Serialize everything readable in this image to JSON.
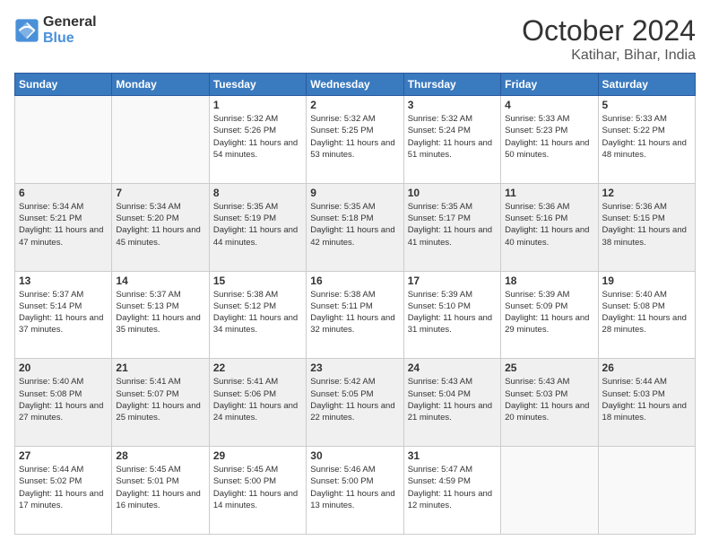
{
  "logo": {
    "line1": "General",
    "line2": "Blue"
  },
  "header": {
    "month": "October 2024",
    "location": "Katihar, Bihar, India"
  },
  "weekdays": [
    "Sunday",
    "Monday",
    "Tuesday",
    "Wednesday",
    "Thursday",
    "Friday",
    "Saturday"
  ],
  "weeks": [
    [
      {
        "day": "",
        "info": ""
      },
      {
        "day": "",
        "info": ""
      },
      {
        "day": "1",
        "info": "Sunrise: 5:32 AM\nSunset: 5:26 PM\nDaylight: 11 hours and 54 minutes."
      },
      {
        "day": "2",
        "info": "Sunrise: 5:32 AM\nSunset: 5:25 PM\nDaylight: 11 hours and 53 minutes."
      },
      {
        "day": "3",
        "info": "Sunrise: 5:32 AM\nSunset: 5:24 PM\nDaylight: 11 hours and 51 minutes."
      },
      {
        "day": "4",
        "info": "Sunrise: 5:33 AM\nSunset: 5:23 PM\nDaylight: 11 hours and 50 minutes."
      },
      {
        "day": "5",
        "info": "Sunrise: 5:33 AM\nSunset: 5:22 PM\nDaylight: 11 hours and 48 minutes."
      }
    ],
    [
      {
        "day": "6",
        "info": "Sunrise: 5:34 AM\nSunset: 5:21 PM\nDaylight: 11 hours and 47 minutes."
      },
      {
        "day": "7",
        "info": "Sunrise: 5:34 AM\nSunset: 5:20 PM\nDaylight: 11 hours and 45 minutes."
      },
      {
        "day": "8",
        "info": "Sunrise: 5:35 AM\nSunset: 5:19 PM\nDaylight: 11 hours and 44 minutes."
      },
      {
        "day": "9",
        "info": "Sunrise: 5:35 AM\nSunset: 5:18 PM\nDaylight: 11 hours and 42 minutes."
      },
      {
        "day": "10",
        "info": "Sunrise: 5:35 AM\nSunset: 5:17 PM\nDaylight: 11 hours and 41 minutes."
      },
      {
        "day": "11",
        "info": "Sunrise: 5:36 AM\nSunset: 5:16 PM\nDaylight: 11 hours and 40 minutes."
      },
      {
        "day": "12",
        "info": "Sunrise: 5:36 AM\nSunset: 5:15 PM\nDaylight: 11 hours and 38 minutes."
      }
    ],
    [
      {
        "day": "13",
        "info": "Sunrise: 5:37 AM\nSunset: 5:14 PM\nDaylight: 11 hours and 37 minutes."
      },
      {
        "day": "14",
        "info": "Sunrise: 5:37 AM\nSunset: 5:13 PM\nDaylight: 11 hours and 35 minutes."
      },
      {
        "day": "15",
        "info": "Sunrise: 5:38 AM\nSunset: 5:12 PM\nDaylight: 11 hours and 34 minutes."
      },
      {
        "day": "16",
        "info": "Sunrise: 5:38 AM\nSunset: 5:11 PM\nDaylight: 11 hours and 32 minutes."
      },
      {
        "day": "17",
        "info": "Sunrise: 5:39 AM\nSunset: 5:10 PM\nDaylight: 11 hours and 31 minutes."
      },
      {
        "day": "18",
        "info": "Sunrise: 5:39 AM\nSunset: 5:09 PM\nDaylight: 11 hours and 29 minutes."
      },
      {
        "day": "19",
        "info": "Sunrise: 5:40 AM\nSunset: 5:08 PM\nDaylight: 11 hours and 28 minutes."
      }
    ],
    [
      {
        "day": "20",
        "info": "Sunrise: 5:40 AM\nSunset: 5:08 PM\nDaylight: 11 hours and 27 minutes."
      },
      {
        "day": "21",
        "info": "Sunrise: 5:41 AM\nSunset: 5:07 PM\nDaylight: 11 hours and 25 minutes."
      },
      {
        "day": "22",
        "info": "Sunrise: 5:41 AM\nSunset: 5:06 PM\nDaylight: 11 hours and 24 minutes."
      },
      {
        "day": "23",
        "info": "Sunrise: 5:42 AM\nSunset: 5:05 PM\nDaylight: 11 hours and 22 minutes."
      },
      {
        "day": "24",
        "info": "Sunrise: 5:43 AM\nSunset: 5:04 PM\nDaylight: 11 hours and 21 minutes."
      },
      {
        "day": "25",
        "info": "Sunrise: 5:43 AM\nSunset: 5:03 PM\nDaylight: 11 hours and 20 minutes."
      },
      {
        "day": "26",
        "info": "Sunrise: 5:44 AM\nSunset: 5:03 PM\nDaylight: 11 hours and 18 minutes."
      }
    ],
    [
      {
        "day": "27",
        "info": "Sunrise: 5:44 AM\nSunset: 5:02 PM\nDaylight: 11 hours and 17 minutes."
      },
      {
        "day": "28",
        "info": "Sunrise: 5:45 AM\nSunset: 5:01 PM\nDaylight: 11 hours and 16 minutes."
      },
      {
        "day": "29",
        "info": "Sunrise: 5:45 AM\nSunset: 5:00 PM\nDaylight: 11 hours and 14 minutes."
      },
      {
        "day": "30",
        "info": "Sunrise: 5:46 AM\nSunset: 5:00 PM\nDaylight: 11 hours and 13 minutes."
      },
      {
        "day": "31",
        "info": "Sunrise: 5:47 AM\nSunset: 4:59 PM\nDaylight: 11 hours and 12 minutes."
      },
      {
        "day": "",
        "info": ""
      },
      {
        "day": "",
        "info": ""
      }
    ]
  ]
}
